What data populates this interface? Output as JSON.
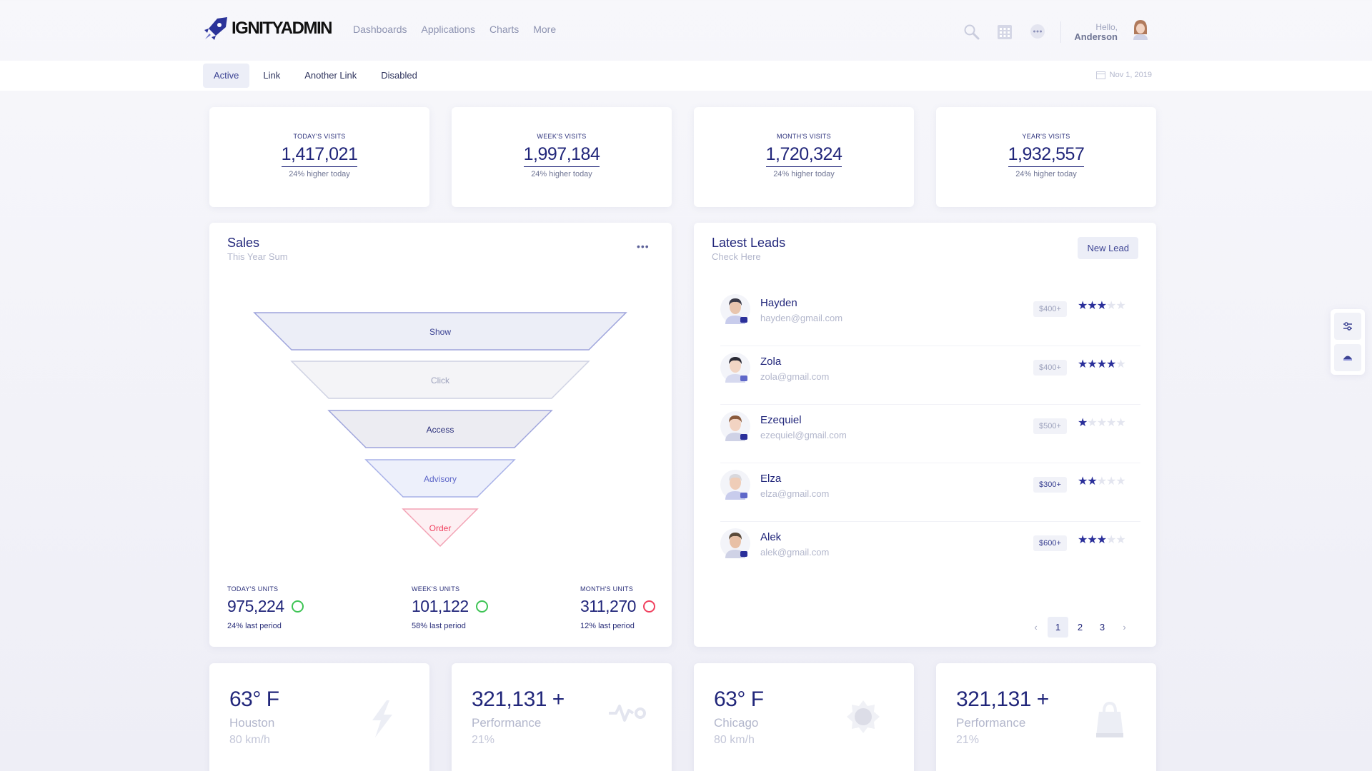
{
  "app": {
    "logo_text": "IGNITYADMIN"
  },
  "nav": [
    "Dashboards",
    "Applications",
    "Charts",
    "More"
  ],
  "user": {
    "greeting": "Hello,",
    "name": "Anderson"
  },
  "tabs": [
    "Active",
    "Link",
    "Another Link",
    "Disabled"
  ],
  "date": "Nov 1, 2019",
  "stats": [
    {
      "label": "TODAY'S VISITS",
      "value": "1,417,021",
      "sub": "24% higher today"
    },
    {
      "label": "WEEK'S VISITS",
      "value": "1,997,184",
      "sub": "24% higher today"
    },
    {
      "label": "MONTH'S VISITS",
      "value": "1,720,324",
      "sub": "24% higher today"
    },
    {
      "label": "YEAR'S VISITS",
      "value": "1,932,557",
      "sub": "24% higher today"
    }
  ],
  "sales": {
    "title": "Sales",
    "subtitle": "This Year Sum",
    "funnel": [
      "Show",
      "Click",
      "Access",
      "Advisory",
      "Order"
    ],
    "units": [
      {
        "label": "TODAY'S UNITS",
        "value": "975,224",
        "sub": "24% last period",
        "status": "green"
      },
      {
        "label": "WEEK'S UNITS",
        "value": "101,122",
        "sub": "58% last period",
        "status": "green"
      },
      {
        "label": "MONTH'S UNITS",
        "value": "311,270",
        "sub": "12% last period",
        "status": "red"
      }
    ]
  },
  "leads": {
    "title": "Latest Leads",
    "subtitle": "Check Here",
    "new_button": "New Lead",
    "items": [
      {
        "name": "Hayden",
        "email": "hayden@gmail.com",
        "price": "$400+",
        "rating": 3
      },
      {
        "name": "Zola",
        "email": "zola@gmail.com",
        "price": "$400+",
        "rating": 4
      },
      {
        "name": "Ezequiel",
        "email": "ezequiel@gmail.com",
        "price": "$500+",
        "rating": 1
      },
      {
        "name": "Elza",
        "email": "elza@gmail.com",
        "price": "$300+",
        "rating": 2
      },
      {
        "name": "Alek",
        "email": "alek@gmail.com",
        "price": "$600+",
        "rating": 3
      }
    ],
    "pages": [
      "1",
      "2",
      "3"
    ],
    "current_page": "1"
  },
  "widgets": [
    {
      "value": "63° F",
      "name": "Houston",
      "sub": "80 km/h",
      "icon": "lightning-icon"
    },
    {
      "value": "321,131 +",
      "name": "Performance",
      "sub": "21%",
      "icon": "pulse-icon"
    },
    {
      "value": "63° F",
      "name": "Chicago",
      "sub": "80 km/h",
      "icon": "sun-icon"
    },
    {
      "value": "321,131 +",
      "name": "Performance",
      "sub": "21%",
      "icon": "bag-icon"
    }
  ],
  "colors": {
    "accent": "#21267a",
    "green": "#3ec455",
    "red": "#f0405e",
    "star": "#2a2f9a"
  }
}
